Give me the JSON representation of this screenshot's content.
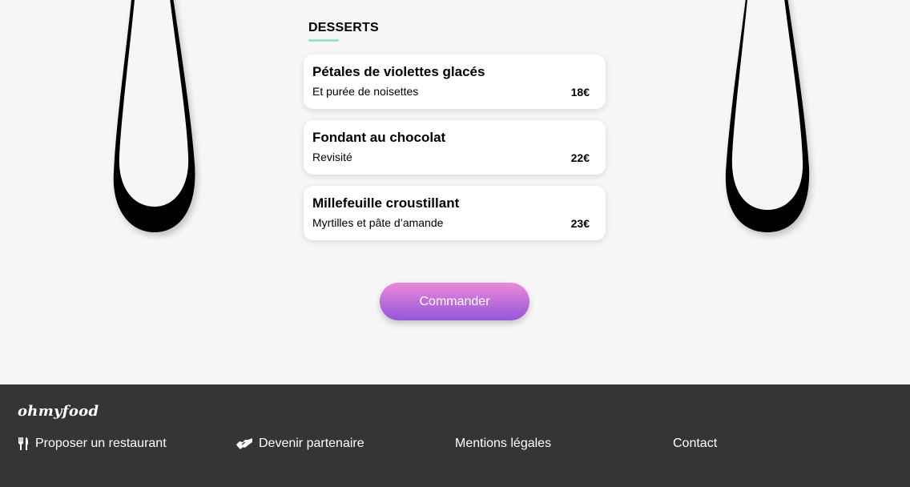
{
  "menu": {
    "section_title": "DESSERTS",
    "dishes": [
      {
        "name": "Pétales de violettes glacés",
        "description": "Et purée de noisettes",
        "price": "18€"
      },
      {
        "name": "Fondant au chocolat",
        "description": "Revisité",
        "price": "22€"
      },
      {
        "name": "Millefeuille croustillant",
        "description": "Myrtilles et pâte d’amande",
        "price": "23€"
      }
    ]
  },
  "order_button": {
    "label": "Commander",
    "gradient_top": "#ee88d8",
    "gradient_bottom": "#9356dc"
  },
  "footer": {
    "logo": "ohmyfood",
    "links": [
      {
        "label": "Proposer un restaurant",
        "icon": "utensils-icon"
      },
      {
        "label": "Devenir partenaire",
        "icon": "handshake-icon"
      },
      {
        "label": "Mentions légales"
      },
      {
        "label": "Contact"
      }
    ],
    "background": "#353535"
  },
  "colors": {
    "page_background": "#f6f6f6",
    "section_underline": "#99e2d0"
  }
}
